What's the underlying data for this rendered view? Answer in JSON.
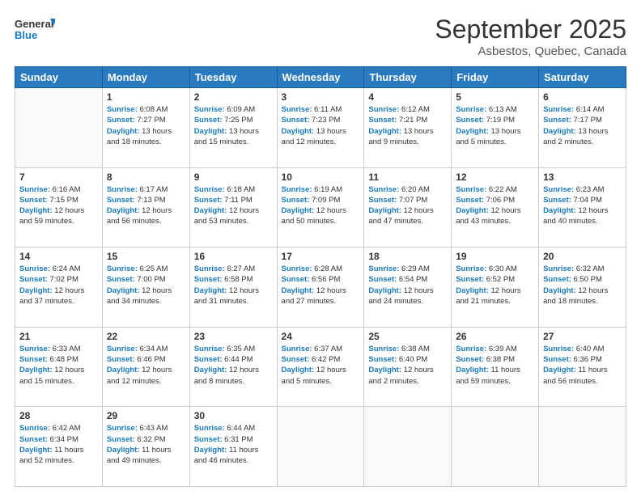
{
  "logo": {
    "line1": "General",
    "line2": "Blue"
  },
  "header": {
    "title": "September 2025",
    "subtitle": "Asbestos, Quebec, Canada"
  },
  "weekdays": [
    "Sunday",
    "Monday",
    "Tuesday",
    "Wednesday",
    "Thursday",
    "Friday",
    "Saturday"
  ],
  "weeks": [
    [
      {
        "day": "",
        "sunrise": "",
        "sunset": "",
        "daylight": ""
      },
      {
        "day": "1",
        "sunrise": "6:08 AM",
        "sunset": "7:27 PM",
        "daylight": "13 hours and 18 minutes."
      },
      {
        "day": "2",
        "sunrise": "6:09 AM",
        "sunset": "7:25 PM",
        "daylight": "13 hours and 15 minutes."
      },
      {
        "day": "3",
        "sunrise": "6:11 AM",
        "sunset": "7:23 PM",
        "daylight": "13 hours and 12 minutes."
      },
      {
        "day": "4",
        "sunrise": "6:12 AM",
        "sunset": "7:21 PM",
        "daylight": "13 hours and 9 minutes."
      },
      {
        "day": "5",
        "sunrise": "6:13 AM",
        "sunset": "7:19 PM",
        "daylight": "13 hours and 5 minutes."
      },
      {
        "day": "6",
        "sunrise": "6:14 AM",
        "sunset": "7:17 PM",
        "daylight": "13 hours and 2 minutes."
      }
    ],
    [
      {
        "day": "7",
        "sunrise": "6:16 AM",
        "sunset": "7:15 PM",
        "daylight": "12 hours and 59 minutes."
      },
      {
        "day": "8",
        "sunrise": "6:17 AM",
        "sunset": "7:13 PM",
        "daylight": "12 hours and 56 minutes."
      },
      {
        "day": "9",
        "sunrise": "6:18 AM",
        "sunset": "7:11 PM",
        "daylight": "12 hours and 53 minutes."
      },
      {
        "day": "10",
        "sunrise": "6:19 AM",
        "sunset": "7:09 PM",
        "daylight": "12 hours and 50 minutes."
      },
      {
        "day": "11",
        "sunrise": "6:20 AM",
        "sunset": "7:07 PM",
        "daylight": "12 hours and 47 minutes."
      },
      {
        "day": "12",
        "sunrise": "6:22 AM",
        "sunset": "7:06 PM",
        "daylight": "12 hours and 43 minutes."
      },
      {
        "day": "13",
        "sunrise": "6:23 AM",
        "sunset": "7:04 PM",
        "daylight": "12 hours and 40 minutes."
      }
    ],
    [
      {
        "day": "14",
        "sunrise": "6:24 AM",
        "sunset": "7:02 PM",
        "daylight": "12 hours and 37 minutes."
      },
      {
        "day": "15",
        "sunrise": "6:25 AM",
        "sunset": "7:00 PM",
        "daylight": "12 hours and 34 minutes."
      },
      {
        "day": "16",
        "sunrise": "6:27 AM",
        "sunset": "6:58 PM",
        "daylight": "12 hours and 31 minutes."
      },
      {
        "day": "17",
        "sunrise": "6:28 AM",
        "sunset": "6:56 PM",
        "daylight": "12 hours and 27 minutes."
      },
      {
        "day": "18",
        "sunrise": "6:29 AM",
        "sunset": "6:54 PM",
        "daylight": "12 hours and 24 minutes."
      },
      {
        "day": "19",
        "sunrise": "6:30 AM",
        "sunset": "6:52 PM",
        "daylight": "12 hours and 21 minutes."
      },
      {
        "day": "20",
        "sunrise": "6:32 AM",
        "sunset": "6:50 PM",
        "daylight": "12 hours and 18 minutes."
      }
    ],
    [
      {
        "day": "21",
        "sunrise": "6:33 AM",
        "sunset": "6:48 PM",
        "daylight": "12 hours and 15 minutes."
      },
      {
        "day": "22",
        "sunrise": "6:34 AM",
        "sunset": "6:46 PM",
        "daylight": "12 hours and 12 minutes."
      },
      {
        "day": "23",
        "sunrise": "6:35 AM",
        "sunset": "6:44 PM",
        "daylight": "12 hours and 8 minutes."
      },
      {
        "day": "24",
        "sunrise": "6:37 AM",
        "sunset": "6:42 PM",
        "daylight": "12 hours and 5 minutes."
      },
      {
        "day": "25",
        "sunrise": "6:38 AM",
        "sunset": "6:40 PM",
        "daylight": "12 hours and 2 minutes."
      },
      {
        "day": "26",
        "sunrise": "6:39 AM",
        "sunset": "6:38 PM",
        "daylight": "11 hours and 59 minutes."
      },
      {
        "day": "27",
        "sunrise": "6:40 AM",
        "sunset": "6:36 PM",
        "daylight": "11 hours and 56 minutes."
      }
    ],
    [
      {
        "day": "28",
        "sunrise": "6:42 AM",
        "sunset": "6:34 PM",
        "daylight": "11 hours and 52 minutes."
      },
      {
        "day": "29",
        "sunrise": "6:43 AM",
        "sunset": "6:32 PM",
        "daylight": "11 hours and 49 minutes."
      },
      {
        "day": "30",
        "sunrise": "6:44 AM",
        "sunset": "6:31 PM",
        "daylight": "11 hours and 46 minutes."
      },
      {
        "day": "",
        "sunrise": "",
        "sunset": "",
        "daylight": ""
      },
      {
        "day": "",
        "sunrise": "",
        "sunset": "",
        "daylight": ""
      },
      {
        "day": "",
        "sunrise": "",
        "sunset": "",
        "daylight": ""
      },
      {
        "day": "",
        "sunrise": "",
        "sunset": "",
        "daylight": ""
      }
    ]
  ],
  "labels": {
    "sunrise": "Sunrise:",
    "sunset": "Sunset:",
    "daylight": "Daylight:"
  }
}
